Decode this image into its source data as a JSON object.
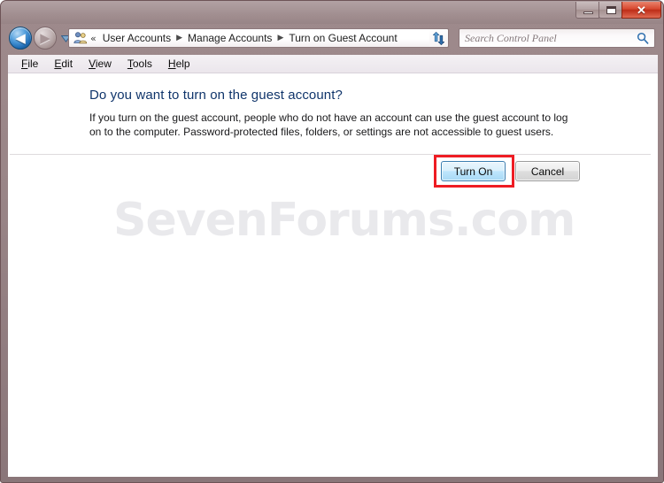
{
  "window": {
    "frame_color": "#9d8789",
    "controls": {
      "minimize": {
        "name": "minimize",
        "glyph": ""
      },
      "maximize": {
        "name": "maximize",
        "glyph": ""
      },
      "close": {
        "name": "close",
        "glyph": "✕",
        "color": "#d8482f"
      }
    }
  },
  "navigation": {
    "back_label": "◀",
    "forward_label": "▶",
    "recent_pages_label": "recent-pages-dropdown",
    "address": {
      "icon": "user-accounts-icon",
      "overflow_chevrons": "«",
      "crumbs": [
        {
          "label": "User Accounts"
        },
        {
          "label": "Manage Accounts"
        },
        {
          "label": "Turn on Guest Account"
        }
      ],
      "separator": "▶",
      "dropdown": "▼"
    },
    "refresh_label": "refresh-icon",
    "search": {
      "placeholder": "Search Control Panel",
      "value": "",
      "icon": "search-icon"
    }
  },
  "menubar": {
    "items": [
      {
        "accel": "F",
        "rest": "ile"
      },
      {
        "accel": "E",
        "rest": "dit"
      },
      {
        "accel": "V",
        "rest": "iew"
      },
      {
        "accel": "T",
        "rest": "ools"
      },
      {
        "accel": "H",
        "rest": "elp"
      }
    ]
  },
  "content": {
    "heading": "Do you want to turn on the guest account?",
    "body": "If you turn on the guest account, people who do not have an account can use the guest account to log on to the computer. Password-protected files, folders, or settings are not accessible to guest users.",
    "watermark": "SevenForums.com",
    "buttons": {
      "primary": "Turn On",
      "secondary": "Cancel"
    },
    "annotation": {
      "target": "Turn On",
      "color": "#ee1c23"
    }
  }
}
